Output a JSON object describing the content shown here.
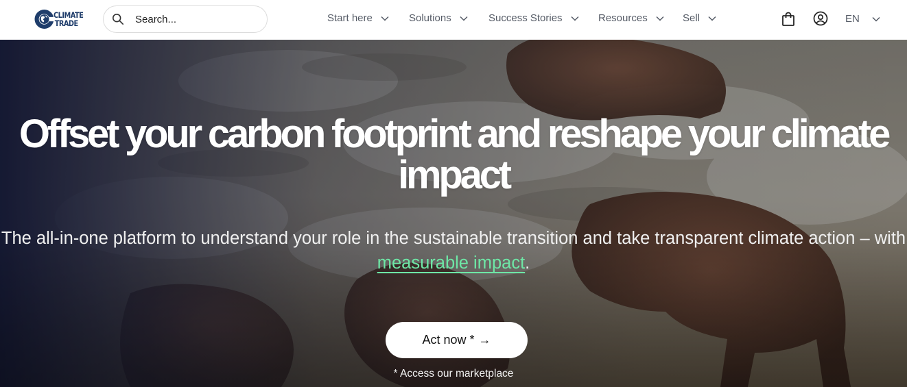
{
  "brand": {
    "logo_line1": "CLIMATE",
    "logo_line2": "TRADE",
    "color": "#1f3d6b"
  },
  "search": {
    "placeholder": "Search..."
  },
  "nav": {
    "items": [
      {
        "label": "Start here"
      },
      {
        "label": "Solutions"
      },
      {
        "label": "Success Stories"
      },
      {
        "label": "Resources"
      },
      {
        "label": "Sell"
      }
    ],
    "language": "EN",
    "icons": [
      "search-icon",
      "cart-icon",
      "user-icon",
      "chevron-down-icon"
    ]
  },
  "hero": {
    "headline": "Offset your carbon footprint and reshape your climate impact",
    "subtitle_part1": "The all-in-one platform to understand your role in the sustainable transition and take transparent climate action – with ",
    "subtitle_link": "measurable impact",
    "subtitle_end": ".",
    "cta_label": "Act now *",
    "cta_arrow": "→",
    "note": "* Access our marketplace",
    "accent_color": "#6ee7a6"
  }
}
